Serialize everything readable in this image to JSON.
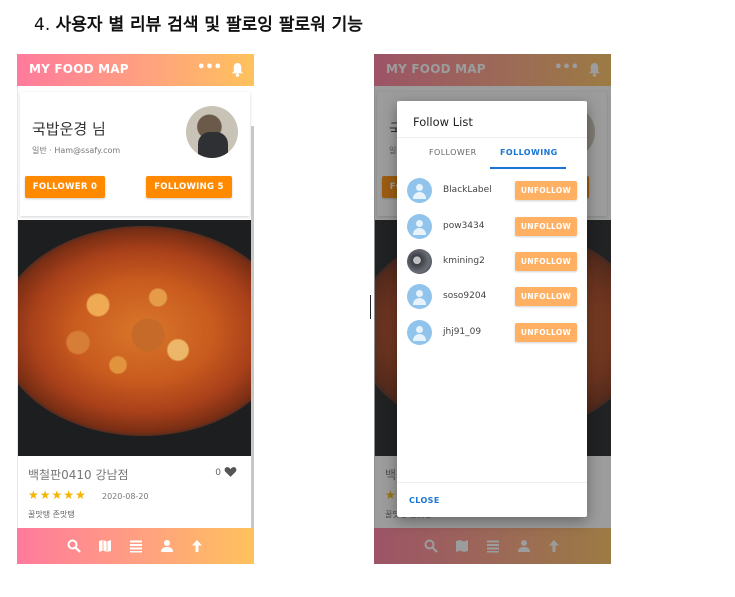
{
  "heading": {
    "number": "4.",
    "text": "사용자 별 리뷰 검색 및 팔로잉 팔로워 기능"
  },
  "app": {
    "title": "MY FOOD MAP",
    "menu_glyph": "•••"
  },
  "profile": {
    "name": "국밥운경 님",
    "subtitle": "일반 · Ham@ssafy.com",
    "follower_button": "FOLLOWER 0",
    "following_button": "FOLLOWING 5"
  },
  "review": {
    "place": "백철판0410 강남점",
    "likes": "0",
    "rating": 5,
    "stars": "★★★★★",
    "date": "2020-08-20",
    "tags": "꿀맛탱 존맛탱"
  },
  "bottom_nav": [
    "search-icon",
    "map-icon",
    "list-icon",
    "person-icon",
    "arrow-up-icon"
  ],
  "dialog": {
    "title": "Follow List",
    "tabs": [
      "FOLLOWER",
      "FOLLOWING"
    ],
    "active_tab": "FOLLOWING",
    "users": [
      {
        "name": "BlackLabel",
        "action": "UNFOLLOW"
      },
      {
        "name": "pow3434",
        "action": "UNFOLLOW"
      },
      {
        "name": "kmining2",
        "action": "UNFOLLOW"
      },
      {
        "name": "soso9204",
        "action": "UNFOLLOW"
      },
      {
        "name": "jhj91_09",
        "action": "UNFOLLOW"
      }
    ],
    "close_label": "CLOSE"
  },
  "colors": {
    "accent_pink": "#ff7a9c",
    "accent_yellow": "#ffc25c",
    "orange": "#ff8a00",
    "blue": "#1976d2"
  }
}
